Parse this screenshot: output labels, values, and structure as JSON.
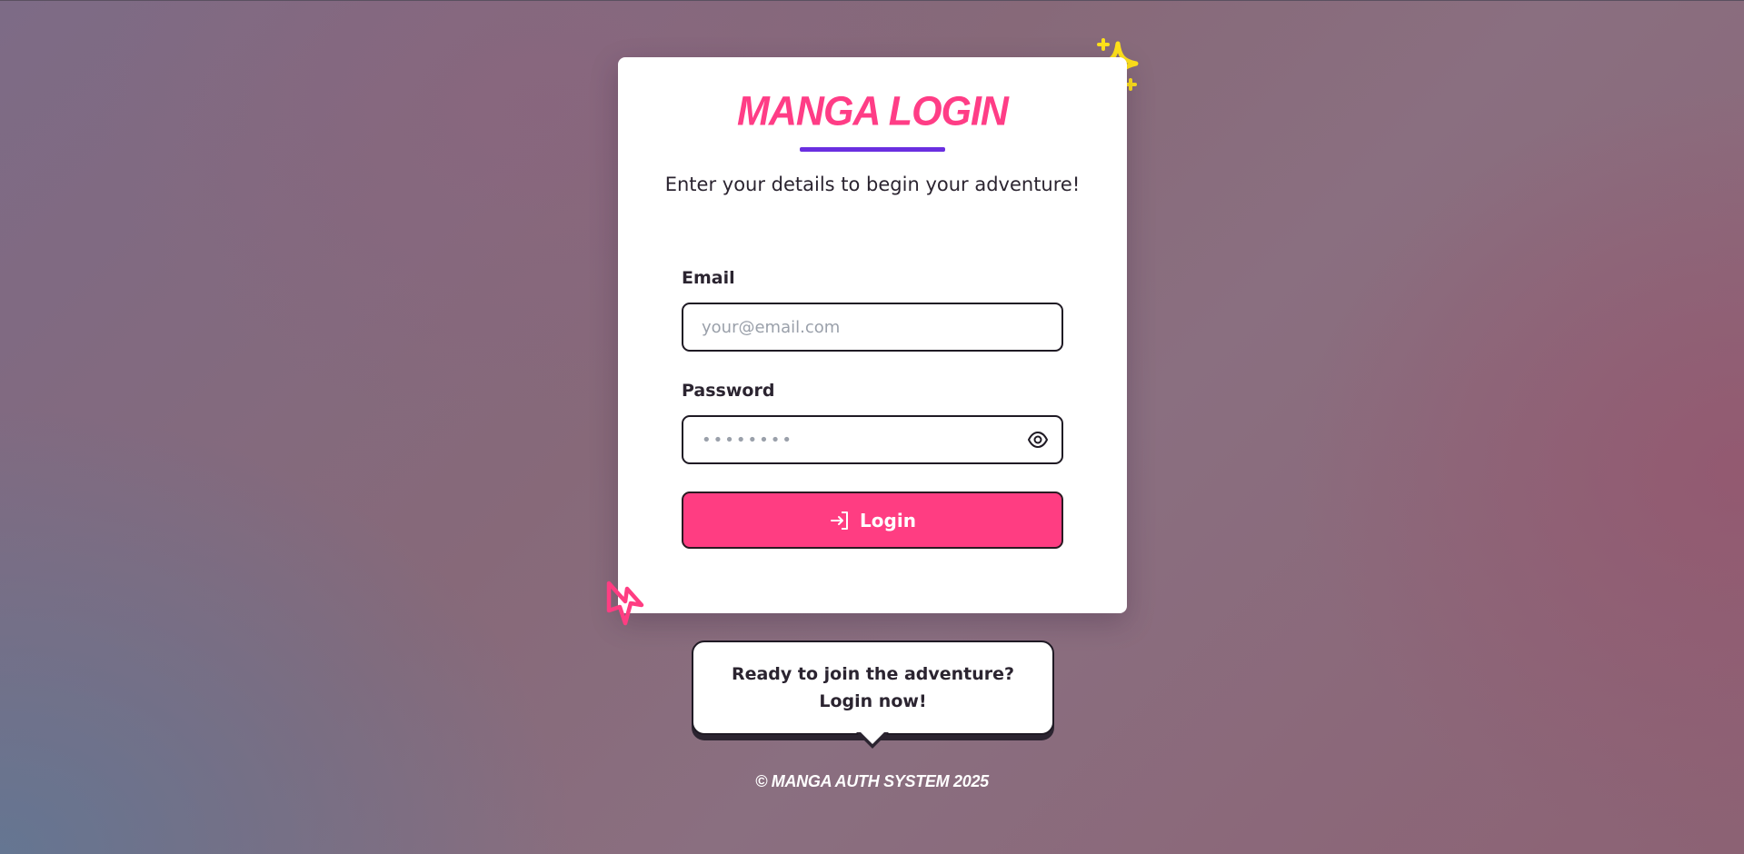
{
  "card": {
    "title": "MANGA LOGIN",
    "subtitle": "Enter your details to begin your adventure!"
  },
  "form": {
    "email_label": "Email",
    "email_placeholder": "your@email.com",
    "email_value": "",
    "password_label": "Password",
    "password_placeholder": "••••••••",
    "password_value": "",
    "login_label": "Login"
  },
  "bubble": {
    "text": "Ready to join the adventure? Login now!"
  },
  "footer": {
    "text": "© MANGA AUTH SYSTEM 2025"
  },
  "icons": {
    "sparkle": "sparkle-icon",
    "bolt": "lightning-icon",
    "eye": "eye-icon",
    "login": "login-arrow-icon"
  },
  "colors": {
    "accent_pink": "#ff3d82",
    "title_pink": "#ff3d86",
    "underline_purple": "#6a2fe0",
    "sparkle_yellow": "#ffe21a"
  }
}
